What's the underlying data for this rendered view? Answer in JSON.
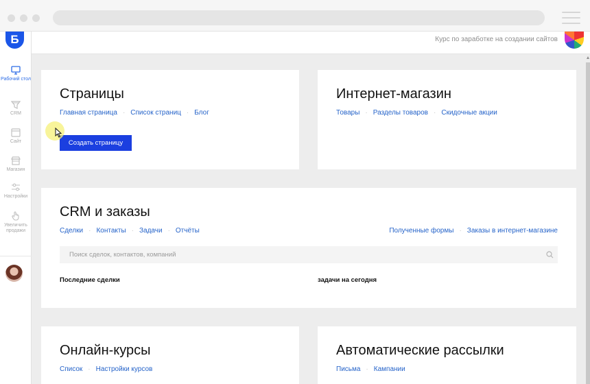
{
  "header": {
    "course_text": "Курс по заработке на создании сайтов"
  },
  "logo": {
    "letter": "Б"
  },
  "sidebar": {
    "items": [
      {
        "label": "Рабочий стол",
        "icon": "desktop-icon",
        "active": true
      },
      {
        "label": "CRM",
        "icon": "funnel-icon",
        "active": false
      },
      {
        "label": "Сайт",
        "icon": "site-icon",
        "active": false
      },
      {
        "label": "Магазин",
        "icon": "store-icon",
        "active": false
      },
      {
        "label": "Настройки",
        "icon": "sliders-icon",
        "active": false
      },
      {
        "label": "Увеличить продажи",
        "icon": "hand-pointer-icon",
        "active": false
      }
    ]
  },
  "cards": {
    "pages": {
      "title": "Страницы",
      "links": [
        "Главная страница",
        "Список страниц",
        "Блог"
      ],
      "button": "Создать страницу"
    },
    "shop": {
      "title": "Интернет-магазин",
      "links": [
        "Товары",
        "Разделы товаров",
        "Скидочные акции"
      ]
    },
    "crm": {
      "title": "CRM и заказы",
      "links_left": [
        "Сделки",
        "Контакты",
        "Задачи",
        "Отчёты"
      ],
      "links_right": [
        "Полученные формы",
        "Заказы в интернет-магазине"
      ],
      "search_placeholder": "Поиск сделок, контактов, компаний",
      "recent_deals": "Последние сделки",
      "tasks_today": "задачи на сегодня"
    },
    "courses": {
      "title": "Онлайн-курсы",
      "links": [
        "Список",
        "Настройки курсов"
      ]
    },
    "mailing": {
      "title": "Автоматические рассылки",
      "links": [
        "Письма",
        "Кампании"
      ]
    }
  },
  "colors": {
    "accent": "#1b3fe0",
    "link": "#2563c9",
    "logo": "#1b56e8",
    "background": "#ededed"
  }
}
